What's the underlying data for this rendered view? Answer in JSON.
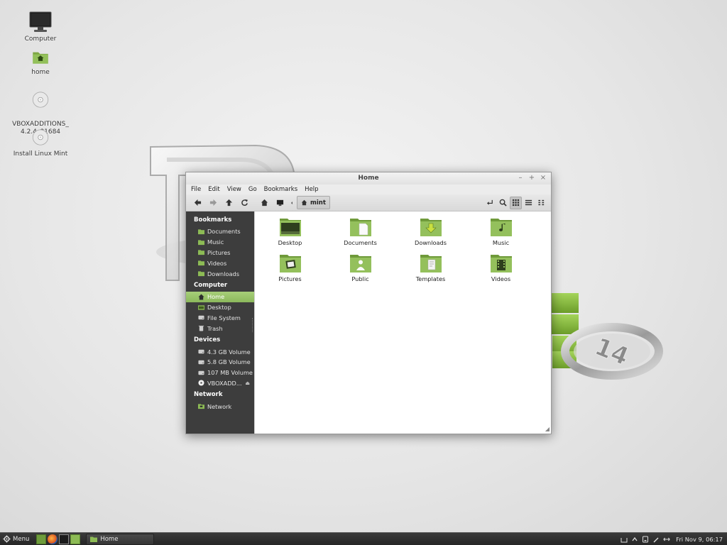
{
  "desktop": {
    "icons": [
      {
        "label": "Computer"
      },
      {
        "label": "home"
      },
      {
        "label": "VBOXADDITIONS_\n4.2.4_81684"
      },
      {
        "label": "Install Linux Mint"
      }
    ],
    "wallpaper_badge": "14"
  },
  "window": {
    "title": "Home",
    "controls": {
      "minimize": "–",
      "maximize": "+",
      "close": "×"
    },
    "menu": [
      "File",
      "Edit",
      "View",
      "Go",
      "Bookmarks",
      "Help"
    ],
    "breadcrumb": "mint",
    "sidebar": {
      "bookmarks_heading": "Bookmarks",
      "bookmarks": [
        "Documents",
        "Music",
        "Pictures",
        "Videos",
        "Downloads"
      ],
      "computer_heading": "Computer",
      "computer": [
        "Home",
        "Desktop",
        "File System",
        "Trash"
      ],
      "selected": "Home",
      "devices_heading": "Devices",
      "devices": [
        "4.3 GB Volume",
        "5.8 GB Volume",
        "107 MB Volume",
        "VBOXADD..."
      ],
      "network_heading": "Network",
      "network": [
        "Network"
      ]
    },
    "files": [
      {
        "name": "Desktop",
        "icon": "desktop-folder"
      },
      {
        "name": "Documents",
        "icon": "documents-folder"
      },
      {
        "name": "Downloads",
        "icon": "downloads-folder"
      },
      {
        "name": "Music",
        "icon": "music-folder"
      },
      {
        "name": "Pictures",
        "icon": "pictures-folder"
      },
      {
        "name": "Public",
        "icon": "public-folder"
      },
      {
        "name": "Templates",
        "icon": "templates-folder"
      },
      {
        "name": "Videos",
        "icon": "videos-folder"
      }
    ]
  },
  "panel": {
    "menu_label": "Menu",
    "task_label": "Home",
    "clock": "Fri Nov  9, 06:17"
  },
  "colors": {
    "mint_green": "#8bb85c",
    "sidebar_bg": "#3d3d3d",
    "panel_bg": "#2e2e2e"
  }
}
